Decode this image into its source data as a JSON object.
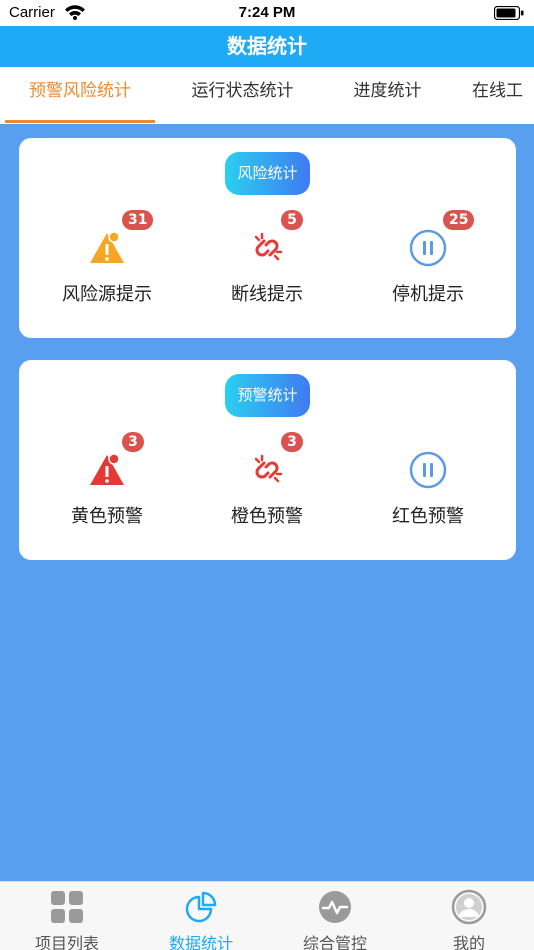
{
  "status_bar": {
    "carrier": "Carrier",
    "time": "7:24 PM"
  },
  "nav": {
    "title": "数据统计"
  },
  "tabs": [
    {
      "label": "预警风险统计",
      "active": true
    },
    {
      "label": "运行状态统计",
      "active": false
    },
    {
      "label": "进度统计",
      "active": false
    },
    {
      "label": "在线工",
      "active": false
    }
  ],
  "cards": [
    {
      "badge": "风险统计",
      "items": [
        {
          "label": "风险源提示",
          "count": "31",
          "icon": "warning-sign-icon"
        },
        {
          "label": "断线提示",
          "count": "5",
          "icon": "broken-link-icon"
        },
        {
          "label": "停机提示",
          "count": "25",
          "icon": "pause-icon"
        }
      ]
    },
    {
      "badge": "预警统计",
      "items": [
        {
          "label": "黄色预警",
          "count": "3",
          "icon": "warning-sign-icon"
        },
        {
          "label": "橙色预警",
          "count": "3",
          "icon": "broken-link-icon"
        },
        {
          "label": "红色预警",
          "count": "",
          "icon": "pause-icon"
        }
      ]
    }
  ],
  "bottom_tabs": [
    {
      "label": "项目列表",
      "icon": "grid-icon",
      "active": false
    },
    {
      "label": "数据统计",
      "icon": "pie-chart-icon",
      "active": true
    },
    {
      "label": "综合管控",
      "icon": "pulse-icon",
      "active": false
    },
    {
      "label": "我的",
      "icon": "user-icon",
      "active": false
    }
  ],
  "colors": {
    "primary": "#1eaaf5",
    "accent": "#f08a2d",
    "background": "#58a0ef",
    "badge_red": "#d9534f",
    "warning_orange": "#f5a623",
    "warning_red": "#e53935"
  }
}
